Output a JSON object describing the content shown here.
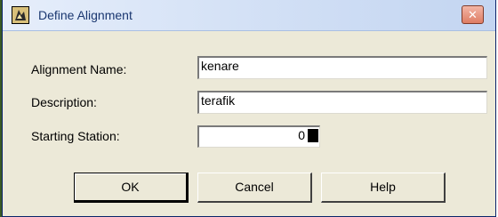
{
  "window": {
    "title": "Define Alignment",
    "close_glyph": "✕"
  },
  "fields": {
    "alignment_name": {
      "label": "Alignment Name:",
      "value": "kenare"
    },
    "description": {
      "label": "Description:",
      "value": "terafik"
    },
    "starting_station": {
      "label": "Starting Station:",
      "value": "0"
    }
  },
  "buttons": {
    "ok": "OK",
    "cancel": "Cancel",
    "help": "Help"
  },
  "icons": {
    "app": "app-icon",
    "close": "close-icon"
  },
  "colors": {
    "dialog_bg": "#ece9d8",
    "titlebar_start": "#e6eefb",
    "titlebar_end": "#c3d5f1",
    "title_text": "#1a3770",
    "close_button": "#de7c63"
  }
}
